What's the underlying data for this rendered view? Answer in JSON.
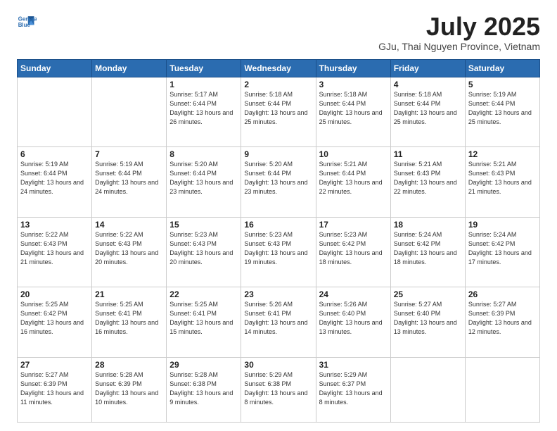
{
  "header": {
    "logo_line1": "General",
    "logo_line2": "Blue",
    "month_title": "July 2025",
    "location": "GJu, Thai Nguyen Province, Vietnam"
  },
  "weekdays": [
    "Sunday",
    "Monday",
    "Tuesday",
    "Wednesday",
    "Thursday",
    "Friday",
    "Saturday"
  ],
  "weeks": [
    [
      {
        "day": "",
        "empty": true
      },
      {
        "day": "",
        "empty": true
      },
      {
        "day": "1",
        "sunrise": "5:17 AM",
        "sunset": "6:44 PM",
        "daylight": "13 hours and 26 minutes."
      },
      {
        "day": "2",
        "sunrise": "5:18 AM",
        "sunset": "6:44 PM",
        "daylight": "13 hours and 25 minutes."
      },
      {
        "day": "3",
        "sunrise": "5:18 AM",
        "sunset": "6:44 PM",
        "daylight": "13 hours and 25 minutes."
      },
      {
        "day": "4",
        "sunrise": "5:18 AM",
        "sunset": "6:44 PM",
        "daylight": "13 hours and 25 minutes."
      },
      {
        "day": "5",
        "sunrise": "5:19 AM",
        "sunset": "6:44 PM",
        "daylight": "13 hours and 25 minutes."
      }
    ],
    [
      {
        "day": "6",
        "sunrise": "5:19 AM",
        "sunset": "6:44 PM",
        "daylight": "13 hours and 24 minutes."
      },
      {
        "day": "7",
        "sunrise": "5:19 AM",
        "sunset": "6:44 PM",
        "daylight": "13 hours and 24 minutes."
      },
      {
        "day": "8",
        "sunrise": "5:20 AM",
        "sunset": "6:44 PM",
        "daylight": "13 hours and 23 minutes."
      },
      {
        "day": "9",
        "sunrise": "5:20 AM",
        "sunset": "6:44 PM",
        "daylight": "13 hours and 23 minutes."
      },
      {
        "day": "10",
        "sunrise": "5:21 AM",
        "sunset": "6:44 PM",
        "daylight": "13 hours and 22 minutes."
      },
      {
        "day": "11",
        "sunrise": "5:21 AM",
        "sunset": "6:43 PM",
        "daylight": "13 hours and 22 minutes."
      },
      {
        "day": "12",
        "sunrise": "5:21 AM",
        "sunset": "6:43 PM",
        "daylight": "13 hours and 21 minutes."
      }
    ],
    [
      {
        "day": "13",
        "sunrise": "5:22 AM",
        "sunset": "6:43 PM",
        "daylight": "13 hours and 21 minutes."
      },
      {
        "day": "14",
        "sunrise": "5:22 AM",
        "sunset": "6:43 PM",
        "daylight": "13 hours and 20 minutes."
      },
      {
        "day": "15",
        "sunrise": "5:23 AM",
        "sunset": "6:43 PM",
        "daylight": "13 hours and 20 minutes."
      },
      {
        "day": "16",
        "sunrise": "5:23 AM",
        "sunset": "6:43 PM",
        "daylight": "13 hours and 19 minutes."
      },
      {
        "day": "17",
        "sunrise": "5:23 AM",
        "sunset": "6:42 PM",
        "daylight": "13 hours and 18 minutes."
      },
      {
        "day": "18",
        "sunrise": "5:24 AM",
        "sunset": "6:42 PM",
        "daylight": "13 hours and 18 minutes."
      },
      {
        "day": "19",
        "sunrise": "5:24 AM",
        "sunset": "6:42 PM",
        "daylight": "13 hours and 17 minutes."
      }
    ],
    [
      {
        "day": "20",
        "sunrise": "5:25 AM",
        "sunset": "6:42 PM",
        "daylight": "13 hours and 16 minutes."
      },
      {
        "day": "21",
        "sunrise": "5:25 AM",
        "sunset": "6:41 PM",
        "daylight": "13 hours and 16 minutes."
      },
      {
        "day": "22",
        "sunrise": "5:25 AM",
        "sunset": "6:41 PM",
        "daylight": "13 hours and 15 minutes."
      },
      {
        "day": "23",
        "sunrise": "5:26 AM",
        "sunset": "6:41 PM",
        "daylight": "13 hours and 14 minutes."
      },
      {
        "day": "24",
        "sunrise": "5:26 AM",
        "sunset": "6:40 PM",
        "daylight": "13 hours and 13 minutes."
      },
      {
        "day": "25",
        "sunrise": "5:27 AM",
        "sunset": "6:40 PM",
        "daylight": "13 hours and 13 minutes."
      },
      {
        "day": "26",
        "sunrise": "5:27 AM",
        "sunset": "6:39 PM",
        "daylight": "13 hours and 12 minutes."
      }
    ],
    [
      {
        "day": "27",
        "sunrise": "5:27 AM",
        "sunset": "6:39 PM",
        "daylight": "13 hours and 11 minutes."
      },
      {
        "day": "28",
        "sunrise": "5:28 AM",
        "sunset": "6:39 PM",
        "daylight": "13 hours and 10 minutes."
      },
      {
        "day": "29",
        "sunrise": "5:28 AM",
        "sunset": "6:38 PM",
        "daylight": "13 hours and 9 minutes."
      },
      {
        "day": "30",
        "sunrise": "5:29 AM",
        "sunset": "6:38 PM",
        "daylight": "13 hours and 8 minutes."
      },
      {
        "day": "31",
        "sunrise": "5:29 AM",
        "sunset": "6:37 PM",
        "daylight": "13 hours and 8 minutes."
      },
      {
        "day": "",
        "empty": true
      },
      {
        "day": "",
        "empty": true
      }
    ]
  ]
}
